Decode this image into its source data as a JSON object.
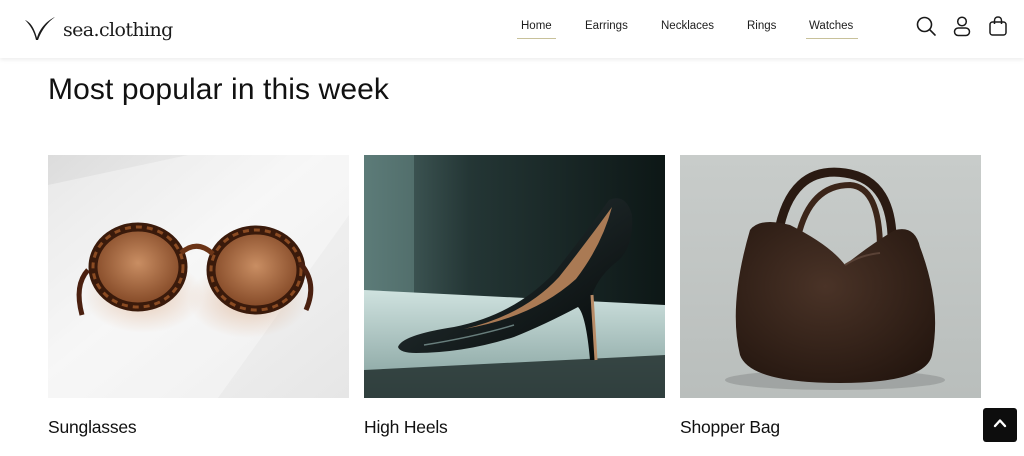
{
  "brand": {
    "name": "sea.clothing",
    "logo_icon": "bird-logo-icon"
  },
  "nav": {
    "items": [
      {
        "label": "Home",
        "active": true
      },
      {
        "label": "Earrings",
        "active": false
      },
      {
        "label": "Necklaces",
        "active": false
      },
      {
        "label": "Rings",
        "active": false
      },
      {
        "label": "Watches",
        "active": true
      }
    ],
    "underline_color": "#c8c19a"
  },
  "header_icons": [
    "search-icon",
    "user-icon",
    "shopping-bag-icon"
  ],
  "section": {
    "title": "Most popular in this week"
  },
  "products": [
    {
      "label": "Sunglasses",
      "image": "sunglasses-image"
    },
    {
      "label": "High Heels",
      "image": "high-heels-image"
    },
    {
      "label": "Shopper Bag",
      "image": "shopper-bag-image"
    }
  ],
  "back_to_top": {
    "icon": "chevron-up-icon",
    "color": "#0d0d0d"
  }
}
